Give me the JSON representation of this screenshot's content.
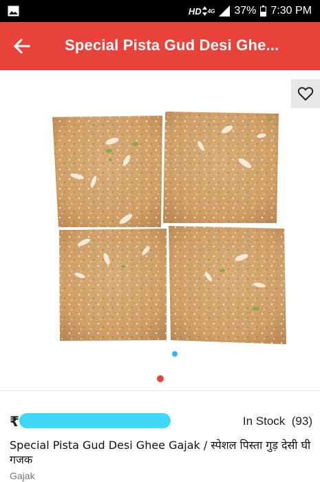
{
  "status_bar": {
    "network": "HD",
    "network_gen": "4G",
    "battery": "37%",
    "time": "7:30 PM",
    "icons": [
      "image-notification-icon",
      "data-arrows-icon",
      "signal-icon",
      "battery-icon"
    ]
  },
  "app_bar": {
    "title": "Special Pista Gud Desi Ghe...",
    "back_icon": "arrow-left-icon",
    "color": "#e8423a"
  },
  "gallery": {
    "image_alt": "square pieces of pista gud desi ghee gajak",
    "wishlist_icon": "heart-outline-icon",
    "pager_color": "#e8423a",
    "inner_dot_color": "#36b3ea"
  },
  "product": {
    "currency": "₹",
    "stock_label": "In Stock",
    "stock_count": "(93)",
    "name": "Special Pista Gud Desi Ghee Gajak / स्पेशल पिस्ता गुड़ देसी घी गजक",
    "category": "Gajak"
  }
}
